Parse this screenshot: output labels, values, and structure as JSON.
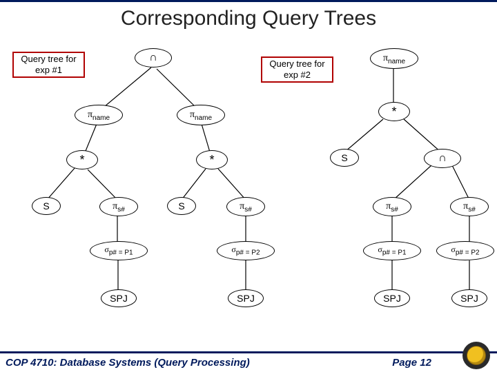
{
  "title": "Corresponding Query Trees",
  "labels": {
    "tree1": "Query tree for\nexp #1",
    "tree2": "Query tree for\nexp #2",
    "intersect": "∩",
    "pi_name": "πname",
    "star": "*",
    "S": "S",
    "pi_s": "πs#",
    "sigma_p1": "σp# = P1",
    "sigma_p2": "σp# = P2",
    "SPJ": "SPJ"
  },
  "footer": {
    "left": "COP 4710: Database Systems (Query Processing)",
    "page": "Page 12"
  }
}
